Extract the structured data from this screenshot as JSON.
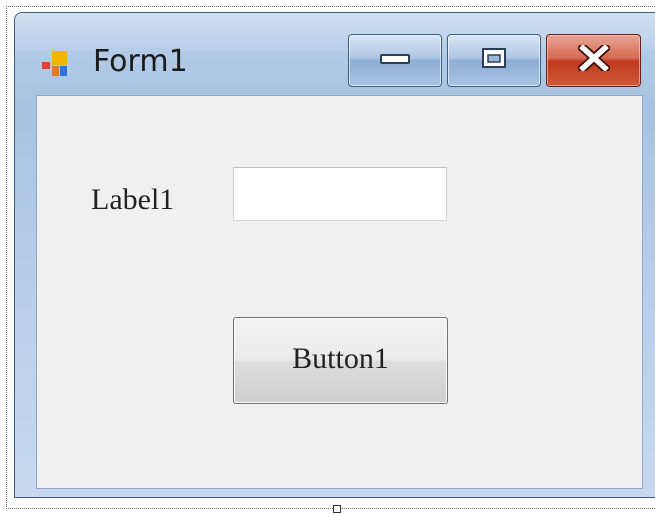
{
  "window": {
    "title": "Form1",
    "icon": "winforms-app-icon",
    "caption_buttons": {
      "minimize": "minimize-icon",
      "maximize": "maximize-icon",
      "close": "close-icon"
    }
  },
  "form": {
    "label_text": "Label1",
    "textbox_value": "",
    "button_label": "Button1"
  },
  "colors": {
    "titlebar": "#a7c2e2",
    "client_background": "#f0f0f0",
    "close_button": "#c2381c"
  }
}
